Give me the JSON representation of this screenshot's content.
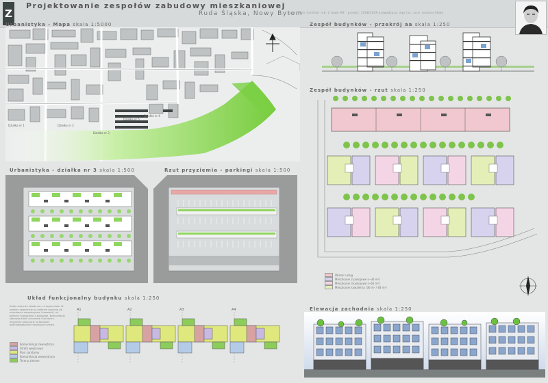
{
  "header": {
    "logo": "Z",
    "title": "Projektowanie zespołów zabudowy mieszkaniowej",
    "subtitle": "Ruda Śląska, Nowy Bytom",
    "credits": "autor: Piotr Cieślicki  rok: 2 skala MS ·  projekt: 2008/2009    prowadzący: mgr inż. arch. Andrzej Skała"
  },
  "sections": {
    "urbanistyka": {
      "title": "Urbanistyka - Mapa",
      "scale": "skala 1:5000"
    },
    "przekroj": {
      "title": "Zespół budynków - przekrój aa",
      "scale": "skala 1:250"
    },
    "rzut": {
      "title": "Zespół budynków - rzut",
      "scale": "skala 1:250"
    },
    "dzialka": {
      "title": "Urbanistyka - działka nr 3",
      "scale": "skala 1:500"
    },
    "parking": {
      "title": "Rzut przyziemia - parkingi",
      "scale": "skala 1:500"
    },
    "funkcja": {
      "title": "Układ funkcjonalny budynku",
      "scale": "skala 1:250"
    },
    "elewacja": {
      "title": "Elewacja zachodnia",
      "scale": "skala 1:250"
    }
  },
  "map_labels": [
    "Działka nr 1",
    "Działka nr 2",
    "Działka nr 3",
    "Działka nr 4",
    "Działka nr 5"
  ],
  "axis_labels": [
    "A1",
    "A2",
    "A3",
    "A4"
  ],
  "rzut_legend": [
    {
      "label": "Obszar usług",
      "color": "#f1c8cf"
    },
    {
      "label": "Mieszkanie 2-pokojowe (~36 m²)",
      "color": "#d7d2ee"
    },
    {
      "label": "Mieszkanie 3-pokojowe (~62 m²)",
      "color": "#f4d5e6"
    },
    {
      "label": "Mieszkanie kawalerka (36 m² / 48 m²)",
      "color": "#e3efb7"
    }
  ],
  "funkcja_legend": [
    {
      "label": "Komunikacja zewnętrzna",
      "color": "#d9a2a2"
    },
    {
      "label": "Strefa wejściowa",
      "color": "#c8b9e3"
    },
    {
      "label": "Pion sanitarny",
      "color": "#dfe87d"
    },
    {
      "label": "Komunikacja wewnętrzna",
      "color": "#b4cbe8"
    },
    {
      "label": "Tereny zielone",
      "color": "#8ccc5b"
    }
  ],
  "funkcja_note": "Każdy budynek składa się z 4 segmentów. W każdym segmencie na parterze znajdują się mieszkania dwupokojowe i kawalerki, na piętrach mieszkania 3-pokojowe. Komunikację stanowią klatki schodowe i korytarze. Segmenty połączone są tarasami ogólnodostępnymi tworzącymi zieleń.",
  "colors": {
    "green": "#8fd65e",
    "lawn": "#dff5c9",
    "road": "#9a9a9a",
    "building": "#4a4f4f"
  }
}
